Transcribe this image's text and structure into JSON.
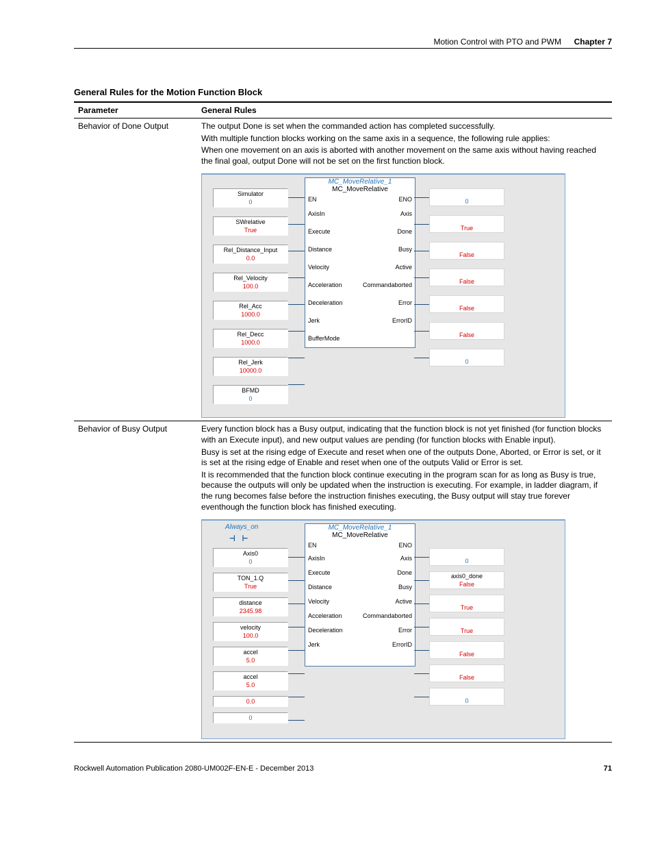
{
  "header": {
    "left": "Motion Control with PTO and PWM",
    "chapter_label": "Chapter 7"
  },
  "section_title": "General Rules for the Motion Function Block",
  "table_headers": {
    "param": "Parameter",
    "rules": "General Rules"
  },
  "rows": [
    {
      "param": "Behavior of Done Output",
      "paras": [
        "The output Done is set when the commanded action has completed successfully.",
        "With multiple function blocks working on the same axis in a sequence, the following rule applies:",
        "When one movement on an axis is aborted with another movement on the same axis without having reached the final goal, output Done will not be set on the first function block."
      ],
      "diagram": {
        "fb_title": "MC_MoveRelative_1",
        "fb_sub": "MC_MoveRelative",
        "en": "EN",
        "eno": "ENO",
        "inputs": [
          {
            "label": "Simulator",
            "value": "0",
            "cls": "val-blue",
            "pin": "AxisIn"
          },
          {
            "label": "SWrelative",
            "value": "True",
            "cls": "val-red",
            "pin": "Execute"
          },
          {
            "label": "Rel_Distance_Input",
            "value": "0.0",
            "cls": "val-red",
            "pin": "Distance"
          },
          {
            "label": "Rel_Velocity",
            "value": "100.0",
            "cls": "val-red",
            "pin": "Velocity"
          },
          {
            "label": "Rel_Acc",
            "value": "1000.0",
            "cls": "val-red",
            "pin": "Acceleration"
          },
          {
            "label": "Rel_Decc",
            "value": "1000.0",
            "cls": "val-red",
            "pin": "Deceleration"
          },
          {
            "label": "Rel_Jerk",
            "value": "10000.0",
            "cls": "val-red",
            "pin": "Jerk"
          },
          {
            "label": "BFMD",
            "value": "0",
            "cls": "val-blue",
            "pin": "BufferMode"
          }
        ],
        "outputs": [
          {
            "label": "",
            "value": "0",
            "cls": "val-blue",
            "pin": "Axis"
          },
          {
            "label": "",
            "value": "True",
            "cls": "val-red",
            "pin": "Done"
          },
          {
            "label": "",
            "value": "False",
            "cls": "val-red",
            "pin": "Busy"
          },
          {
            "label": "",
            "value": "False",
            "cls": "val-red",
            "pin": "Active"
          },
          {
            "label": "",
            "value": "False",
            "cls": "val-red",
            "pin": "Commandaborted"
          },
          {
            "label": "",
            "value": "False",
            "cls": "val-red",
            "pin": "Error"
          },
          {
            "label": "",
            "value": "0",
            "cls": "val-blue",
            "pin": "ErrorID"
          }
        ]
      }
    },
    {
      "param": "Behavior of Busy Output",
      "paras": [
        "Every function block has a Busy output, indicating that the function block is not yet finished (for function blocks with an Execute input), and new output values are pending (for function blocks with Enable input).",
        "Busy is set at the rising edge of Execute and reset when one of the outputs Done, Aborted, or Error is set, or it is set at the rising edge of Enable and reset when one of the outputs Valid or Error is set.",
        "It is recommended that the function block continue executing in the program scan for as long as Busy is true, because the outputs will only be updated when the instruction is executing. For example, in ladder diagram, if the rung becomes false before the instruction finishes executing, the Busy output will stay true forever eventhough the function block has finished executing."
      ],
      "diagram": {
        "always_on": "Always_on",
        "fb_title": "MC_MoveRelative_1",
        "fb_sub": "MC_MoveRelative",
        "en": "EN",
        "eno": "ENO",
        "inputs": [
          {
            "label": "Axis0",
            "value": "0",
            "cls": "val-blue",
            "pin": "AxisIn"
          },
          {
            "label": "TON_1.Q",
            "value": "True",
            "cls": "val-red",
            "pin": "Execute"
          },
          {
            "label": "distance",
            "value": "2345.98",
            "cls": "val-red",
            "pin": "Distance"
          },
          {
            "label": "velocity",
            "value": "100.0",
            "cls": "val-red",
            "pin": "Velocity"
          },
          {
            "label": "accel",
            "value": "5.0",
            "cls": "val-red",
            "pin": "Acceleration"
          },
          {
            "label": "accel",
            "value": "5.0",
            "cls": "val-red",
            "pin": "Deceleration"
          },
          {
            "label": "",
            "value": "0.0",
            "cls": "val-red",
            "pin": "Jerk"
          },
          {
            "label": "",
            "value": "0",
            "cls": "val-blue",
            "pin": ""
          }
        ],
        "outputs": [
          {
            "label": "",
            "value": "0",
            "cls": "val-blue",
            "pin": "Axis"
          },
          {
            "label": "axis0_done",
            "value": "False",
            "cls": "val-red",
            "pin": "Done"
          },
          {
            "label": "",
            "value": "True",
            "cls": "val-red",
            "pin": "Busy"
          },
          {
            "label": "",
            "value": "True",
            "cls": "val-red",
            "pin": "Active"
          },
          {
            "label": "",
            "value": "False",
            "cls": "val-red",
            "pin": "Commandaborted"
          },
          {
            "label": "",
            "value": "False",
            "cls": "val-red",
            "pin": "Error"
          },
          {
            "label": "",
            "value": "0",
            "cls": "val-blue",
            "pin": "ErrorID"
          }
        ]
      }
    }
  ],
  "footer": {
    "left": "Rockwell Automation Publication 2080-UM002F-EN-E - December 2013",
    "page": "71"
  }
}
